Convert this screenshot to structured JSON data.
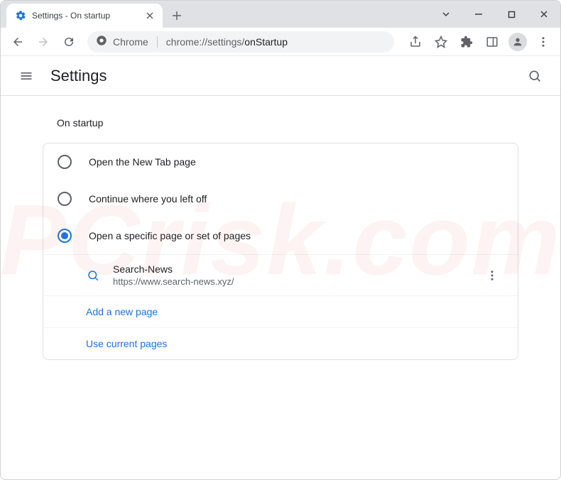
{
  "tab": {
    "title": "Settings - On startup"
  },
  "omnibox": {
    "chrome_label": "Chrome",
    "url_prefix": "chrome://settings/",
    "url_path": "onStartup"
  },
  "settings": {
    "title": "Settings"
  },
  "section": {
    "title": "On startup"
  },
  "radios": {
    "new_tab": "Open the New Tab page",
    "continue": "Continue where you left off",
    "specific": "Open a specific page or set of pages"
  },
  "startup_page": {
    "name": "Search-News",
    "url": "https://www.search-news.xyz/"
  },
  "links": {
    "add_page": "Add a new page",
    "use_current": "Use current pages"
  },
  "watermark": "PCrisk.com"
}
